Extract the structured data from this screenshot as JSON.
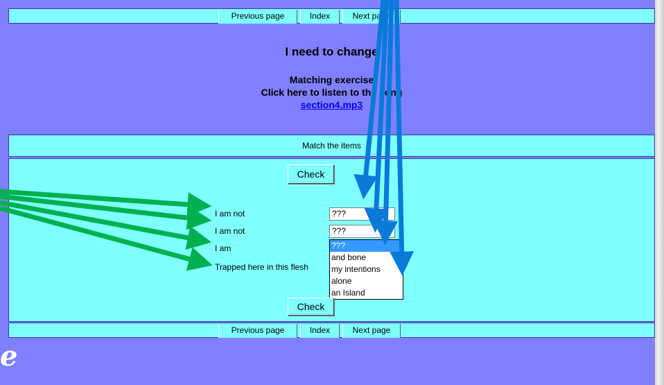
{
  "nav": {
    "previous_label": "Previous page",
    "index_label": "Index",
    "next_label": "Next page"
  },
  "header": {
    "song_title": "I need to change",
    "exercise_title": "Matching exercise",
    "listen_text": "Click here to listen to the song",
    "audio_link": "section4.mp3"
  },
  "instructions": "Match the items",
  "exercise": {
    "check_label": "Check",
    "rows": [
      {
        "label": "I am not",
        "selected": "???"
      },
      {
        "label": "I am not",
        "selected": "???"
      },
      {
        "label": "I am",
        "selected": ""
      },
      {
        "label": "Trapped here in this flesh",
        "selected": ""
      }
    ],
    "dropdown_options": [
      "???",
      "and bone",
      "my intentions",
      "alone",
      "an Island"
    ],
    "dropdown_highlighted": "???"
  },
  "corner_text": "e",
  "colors": {
    "page_bg": "#8080ff",
    "panel_bg": "#80ffff",
    "highlight": "#3399ff",
    "green_arrow": "#00b050",
    "blue_arrow": "#0a7ad8"
  }
}
